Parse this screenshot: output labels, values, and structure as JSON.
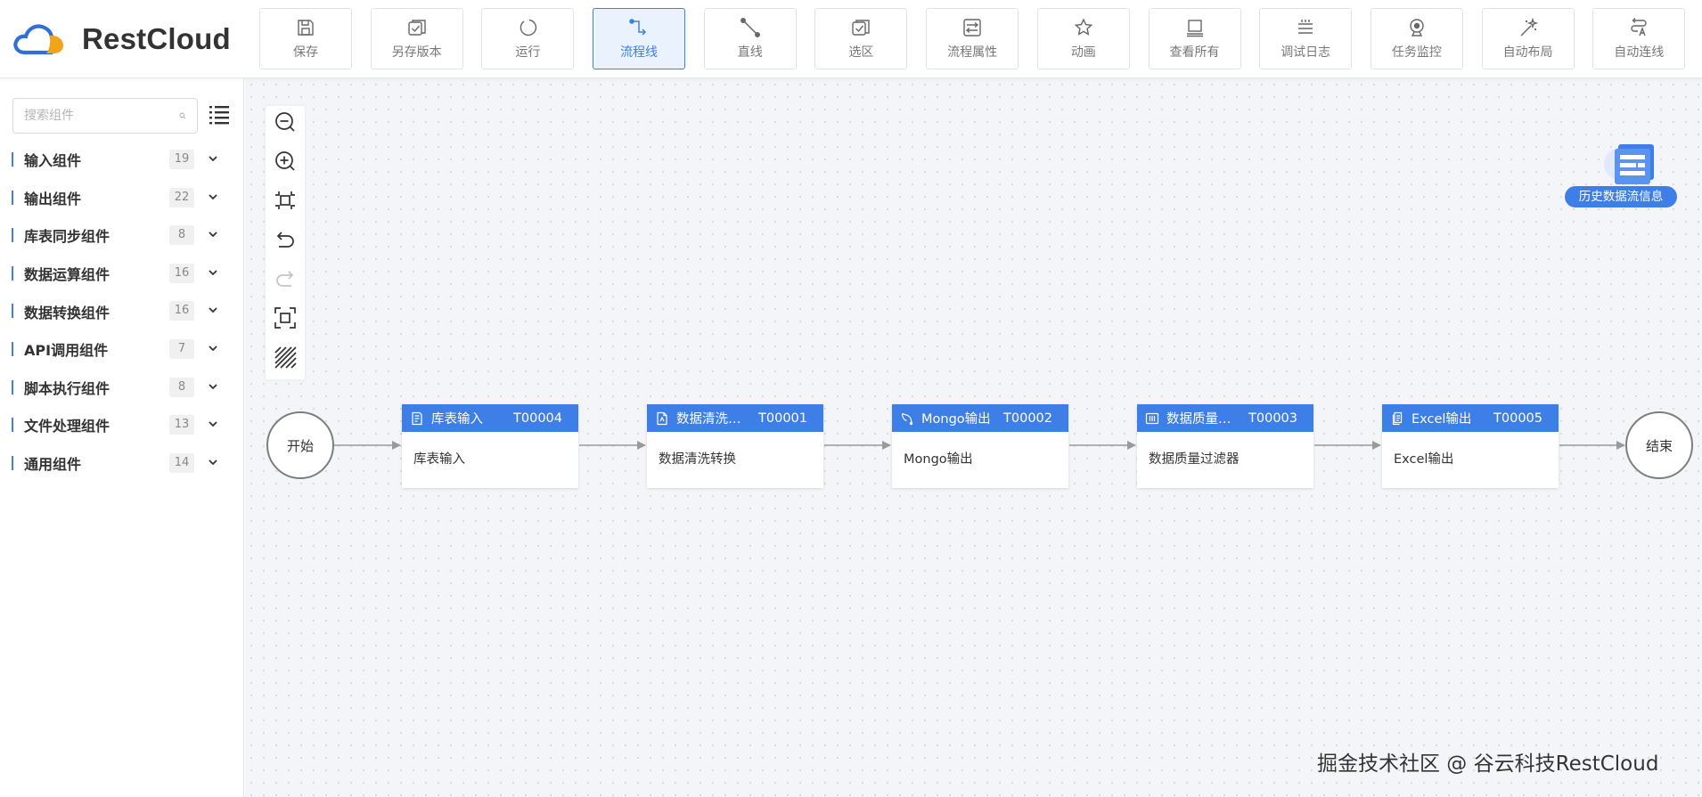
{
  "app": {
    "logo_text": "RestCloud"
  },
  "toolbar": [
    {
      "label": "保存",
      "icon": "save-icon"
    },
    {
      "label": "另存版本",
      "icon": "save-version-icon"
    },
    {
      "label": "运行",
      "icon": "run-icon"
    },
    {
      "label": "流程线",
      "icon": "flow-line-icon",
      "active": true
    },
    {
      "label": "直线",
      "icon": "straight-line-icon"
    },
    {
      "label": "选区",
      "icon": "selection-icon"
    },
    {
      "label": "流程属性",
      "icon": "flow-properties-icon"
    },
    {
      "label": "动画",
      "icon": "animation-icon"
    },
    {
      "label": "查看所有",
      "icon": "view-all-icon"
    },
    {
      "label": "调试日志",
      "icon": "debug-log-icon"
    },
    {
      "label": "任务监控",
      "icon": "task-monitor-icon"
    },
    {
      "label": "自动布局",
      "icon": "auto-layout-icon"
    },
    {
      "label": "自动连线",
      "icon": "auto-connect-icon"
    }
  ],
  "sidebar": {
    "search_placeholder": "搜索组件",
    "categories": [
      {
        "label": "输入组件",
        "count": "19"
      },
      {
        "label": "输出组件",
        "count": "22"
      },
      {
        "label": "库表同步组件",
        "count": "8"
      },
      {
        "label": "数据运算组件",
        "count": "16"
      },
      {
        "label": "数据转换组件",
        "count": "16"
      },
      {
        "label": "API调用组件",
        "count": "7"
      },
      {
        "label": "脚本执行组件",
        "count": "8"
      },
      {
        "label": "文件处理组件",
        "count": "13"
      },
      {
        "label": "通用组件",
        "count": "14"
      }
    ]
  },
  "canvas": {
    "history_label": "历史数据流信息",
    "start_label": "开始",
    "end_label": "结束",
    "nodes": [
      {
        "name": "库表输入",
        "code": "T00004",
        "desc": "库表输入",
        "icon": "table-input-icon"
      },
      {
        "name": "数据清洗…",
        "code": "T00001",
        "desc": "数据清洗转换",
        "icon": "data-clean-icon"
      },
      {
        "name": "Mongo输出",
        "code": "T00002",
        "desc": "Mongo输出",
        "icon": "mongo-icon"
      },
      {
        "name": "数据质量…",
        "code": "T00003",
        "desc": "数据质量过滤器",
        "icon": "data-quality-icon"
      },
      {
        "name": "Excel输出",
        "code": "T00005",
        "desc": "Excel输出",
        "icon": "excel-icon"
      }
    ]
  },
  "watermark": "掘金技术社区 @ 谷云科技RestCloud",
  "colors": {
    "accent": "#3d7fe6",
    "canvas_bg": "#f4f5f8",
    "edge": "#9a9a9a"
  }
}
